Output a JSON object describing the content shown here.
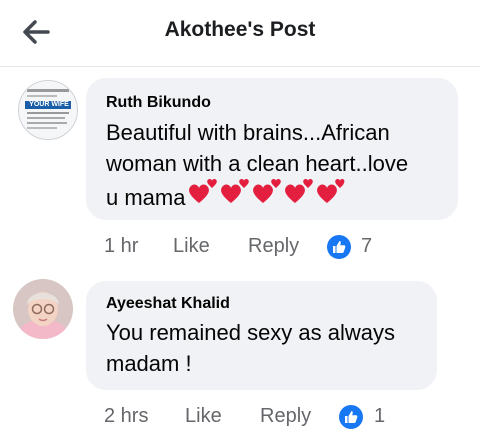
{
  "header": {
    "title": "Akothee's Post",
    "back_icon": "arrow-left-icon"
  },
  "comments": [
    {
      "author": "Ruth Bikundo",
      "text_line1": "Beautiful with brains...African",
      "text_line2": "woman with a clean heart..love",
      "text_line3": "u mama",
      "emoji": "heart-emoji x5",
      "avatar_text": "YOUR WIFE",
      "time": "1 hr",
      "like_label": "Like",
      "reply_label": "Reply",
      "reaction_icon": "thumbs-up-icon",
      "reaction_count": "7"
    },
    {
      "author": "Ayeeshat Khalid",
      "text_line1": "You remained sexy as always",
      "text_line2": "madam !",
      "time": "2 hrs",
      "like_label": "Like",
      "reply_label": "Reply",
      "reaction_icon": "thumbs-up-icon",
      "reaction_count": "1"
    }
  ],
  "colors": {
    "bubble": "#f0f2f5",
    "meta": "#65676b",
    "like_blue": "#1877f2",
    "heart": "#e41e3f"
  }
}
